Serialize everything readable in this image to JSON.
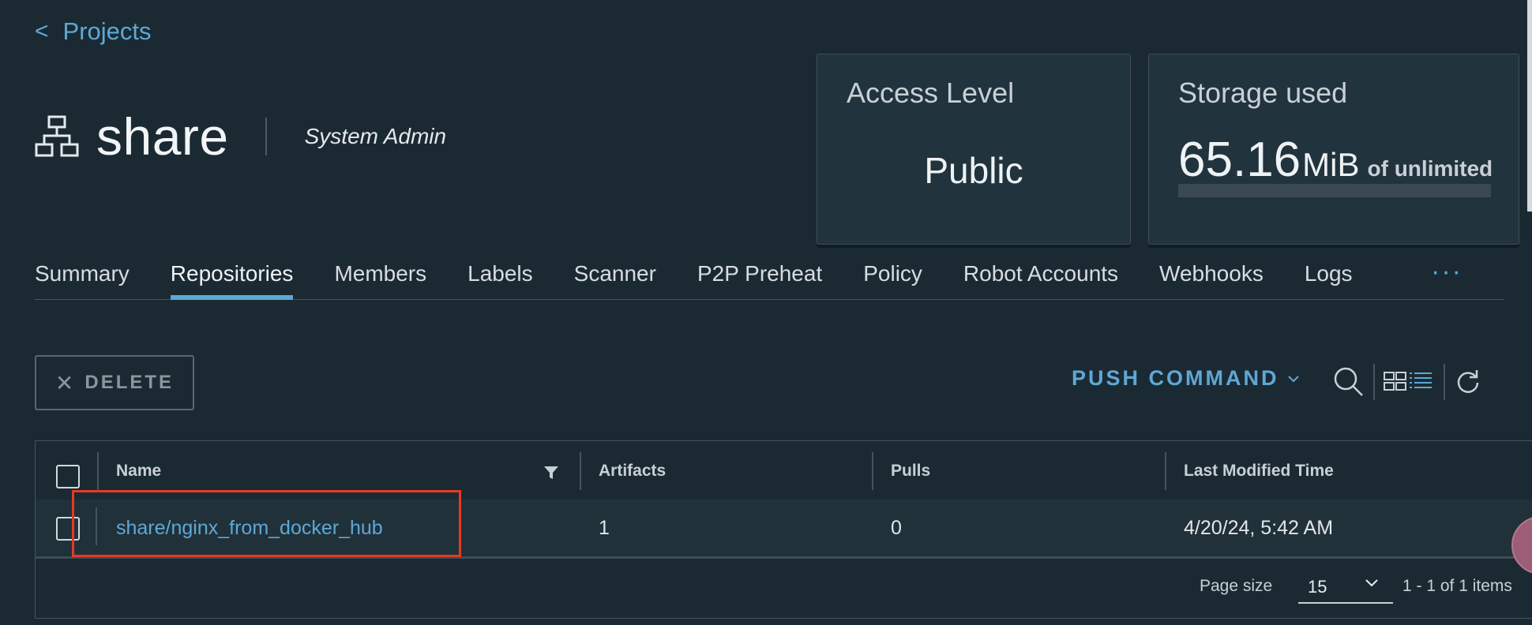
{
  "nav": {
    "back_label": "Projects"
  },
  "project": {
    "name": "share",
    "role": "System Admin"
  },
  "cards": {
    "access": {
      "title": "Access Level",
      "value": "Public"
    },
    "storage": {
      "title": "Storage used",
      "amount": "65.16",
      "unit": "MiB",
      "suffix": "of unlimited",
      "fill_fraction": 0
    }
  },
  "tabs": [
    {
      "label": "Summary"
    },
    {
      "label": "Repositories",
      "active": true
    },
    {
      "label": "Members"
    },
    {
      "label": "Labels"
    },
    {
      "label": "Scanner"
    },
    {
      "label": "P2P Preheat"
    },
    {
      "label": "Policy"
    },
    {
      "label": "Robot Accounts"
    },
    {
      "label": "Webhooks"
    },
    {
      "label": "Logs"
    }
  ],
  "tabs_more": "···",
  "toolbar": {
    "delete_label": "DELETE",
    "push_command_label": "PUSH COMMAND"
  },
  "table": {
    "columns": [
      "Name",
      "Artifacts",
      "Pulls",
      "Last Modified Time"
    ],
    "rows": [
      {
        "name": "share/nginx_from_docker_hub",
        "artifacts": "1",
        "pulls": "0",
        "modified": "4/20/24, 5:42 AM"
      }
    ],
    "footer": {
      "page_size_label": "Page size",
      "page_size": "15",
      "summary": "1 - 1 of 1 items"
    }
  },
  "colors": {
    "background": "#1b2a32",
    "accent": "#5ea8d6",
    "highlight": "#e53b24"
  },
  "icons": [
    "chevron-left-icon",
    "project-tree-icon",
    "close-icon",
    "chevron-down-icon",
    "search-icon",
    "card-view-icon",
    "list-view-icon",
    "refresh-icon",
    "filter-icon"
  ]
}
